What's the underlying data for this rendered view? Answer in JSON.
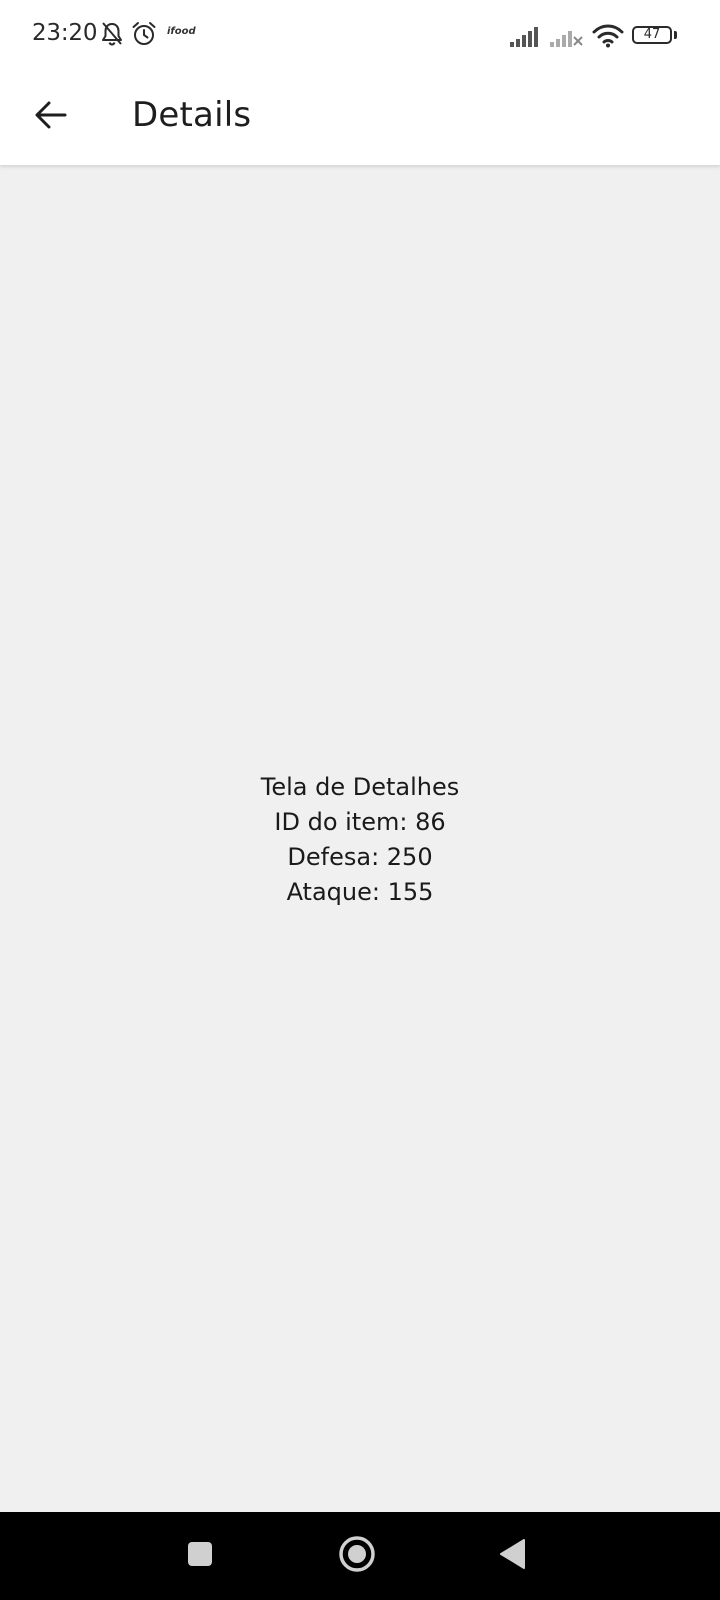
{
  "status_bar": {
    "time": "23:20",
    "app_notification_label": "ifood",
    "battery_level": "47",
    "icons": [
      "bell-off-icon",
      "alarm-icon",
      "ifood-icon",
      "signal-icon",
      "signal-no-service-icon",
      "wifi-icon",
      "battery-icon"
    ]
  },
  "app_bar": {
    "title": "Details",
    "back_icon": "arrow-back-icon"
  },
  "details": {
    "heading": "Tela de Detalhes",
    "item_id": "ID do item: 86",
    "defense": "Defesa: 250",
    "attack": "Ataque: 155"
  },
  "nav_bar": {
    "icons": [
      "recents-square-icon",
      "home-circle-icon",
      "back-triangle-icon"
    ]
  },
  "colors": {
    "background": "#f0f0f0",
    "app_bar": "#ffffff",
    "nav_bar": "#000000",
    "text": "#1c1c1c"
  }
}
